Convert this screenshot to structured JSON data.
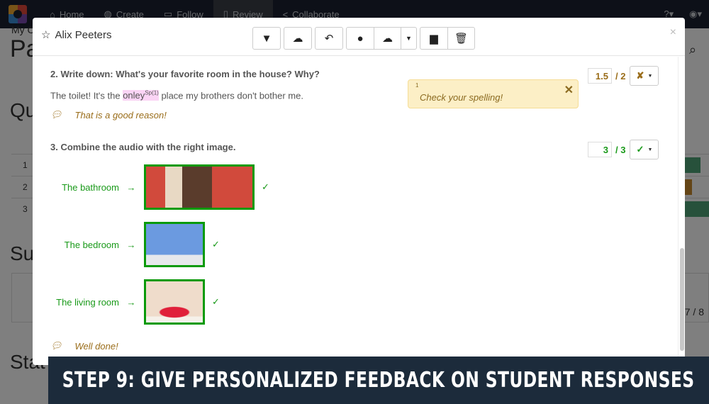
{
  "nav": {
    "items": [
      {
        "label": "Home",
        "icon": "home-icon"
      },
      {
        "label": "Create",
        "icon": "palette-icon"
      },
      {
        "label": "Follow",
        "icon": "video-icon"
      },
      {
        "label": "Review",
        "icon": "clipboard-icon",
        "active": true
      },
      {
        "label": "Collaborate",
        "icon": "share-icon"
      }
    ],
    "help_icon": "question-icon",
    "user_icon": "user-circle-icon"
  },
  "background": {
    "breadcrumb": "My C",
    "title": "Pa",
    "sections": [
      "Qu",
      "Sul",
      "Stat"
    ],
    "rows": [
      "1",
      "2",
      "3"
    ],
    "score": "7 / 8",
    "bar_colors": [
      "#4fa377",
      "#c98a2c",
      "#4fa377"
    ]
  },
  "modal": {
    "title": "Alix Peeters",
    "toolbar": [
      "filter",
      "cloud-download",
      "undo-pen",
      "user",
      "cloud-user",
      "archive",
      "trash"
    ],
    "questions": [
      {
        "title": "2. Write down: What's your favorite room in the house? Why?",
        "answer_before": "The toilet! It's the ",
        "answer_marked": "onley",
        "answer_mark_sup": "Sp(1)",
        "answer_after": " place my brothers don't bother me.",
        "feedback": "That is a good reason!",
        "note": {
          "number": "1",
          "text": "Check your spelling!"
        },
        "score": "1.5",
        "max": "/ 2",
        "status": "✘",
        "color": "#9a6d1a"
      },
      {
        "title": "3. Combine the audio with the right image.",
        "matches": [
          {
            "label": "The bathroom",
            "arrow": "→",
            "check": "✓"
          },
          {
            "label": "The bedroom",
            "arrow": "→",
            "check": "✓"
          },
          {
            "label": "The living room",
            "arrow": "→",
            "check": "✓"
          }
        ],
        "feedback": "Well done!",
        "score": "3",
        "max": "/ 3",
        "status": "✓",
        "color": "#1a9a1a"
      }
    ]
  },
  "banner": "STEP 9: GIVE PERSONALIZED FEEDBACK ON STUDENT RESPONSES"
}
